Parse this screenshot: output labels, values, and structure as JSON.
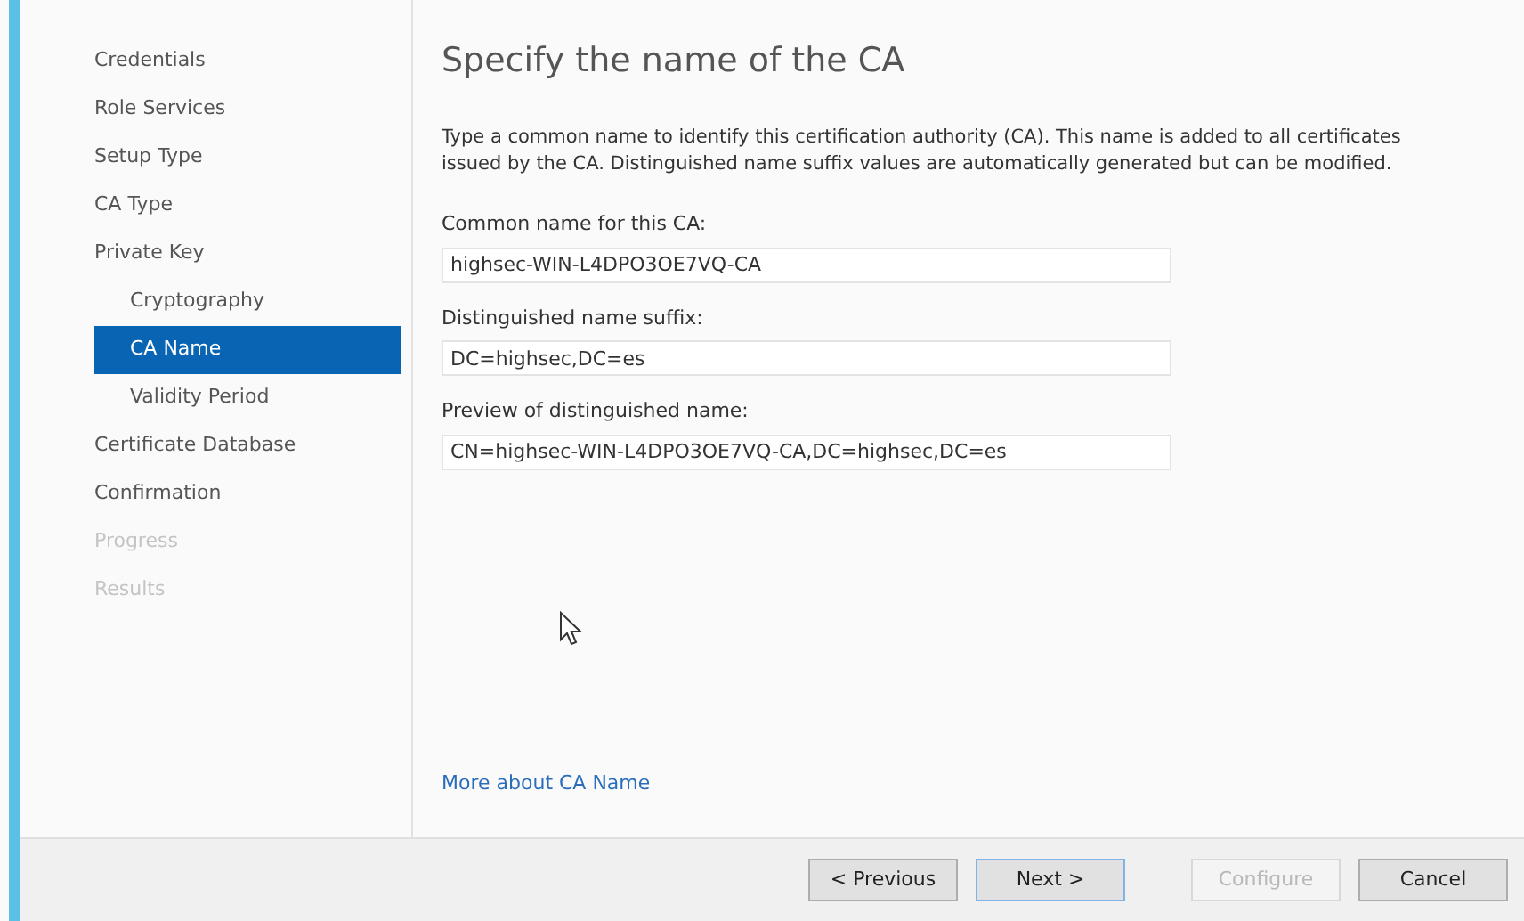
{
  "sidebar": {
    "items": [
      {
        "label": "Credentials",
        "selected": false,
        "disabled": false
      },
      {
        "label": "Role Services",
        "selected": false,
        "disabled": false
      },
      {
        "label": "Setup Type",
        "selected": false,
        "disabled": false
      },
      {
        "label": "CA Type",
        "selected": false,
        "disabled": false
      },
      {
        "label": "Private Key",
        "selected": false,
        "disabled": false,
        "children": [
          {
            "label": "Cryptography",
            "selected": false,
            "disabled": false
          },
          {
            "label": "CA Name",
            "selected": true,
            "disabled": false
          },
          {
            "label": "Validity Period",
            "selected": false,
            "disabled": false
          }
        ]
      },
      {
        "label": "Certificate Database",
        "selected": false,
        "disabled": false
      },
      {
        "label": "Confirmation",
        "selected": false,
        "disabled": false
      },
      {
        "label": "Progress",
        "selected": false,
        "disabled": true
      },
      {
        "label": "Results",
        "selected": false,
        "disabled": true
      }
    ]
  },
  "title": "Specify the name of the CA",
  "description": "Type a common name to identify this certification authority (CA). This name is added to all certificates issued by the CA. Distinguished name suffix values are automatically generated but can be modified.",
  "fields": [
    {
      "label": "Common name for this CA:",
      "value": "highsec-WIN-L4DPO3OE7VQ-CA"
    },
    {
      "label": "Distinguished name suffix:",
      "value": "DC=highsec,DC=es"
    },
    {
      "label": "Preview of distinguished name:",
      "value": "CN=highsec-WIN-L4DPO3OE7VQ-CA,DC=highsec,DC=es"
    }
  ],
  "link": "More about CA Name",
  "buttons": [
    {
      "label": "< Previous",
      "disabled": false,
      "default": false
    },
    {
      "label": "Next >",
      "disabled": false,
      "default": true
    },
    {
      "label": "Configure",
      "disabled": true,
      "default": false
    },
    {
      "label": "Cancel",
      "disabled": false,
      "default": false
    }
  ]
}
